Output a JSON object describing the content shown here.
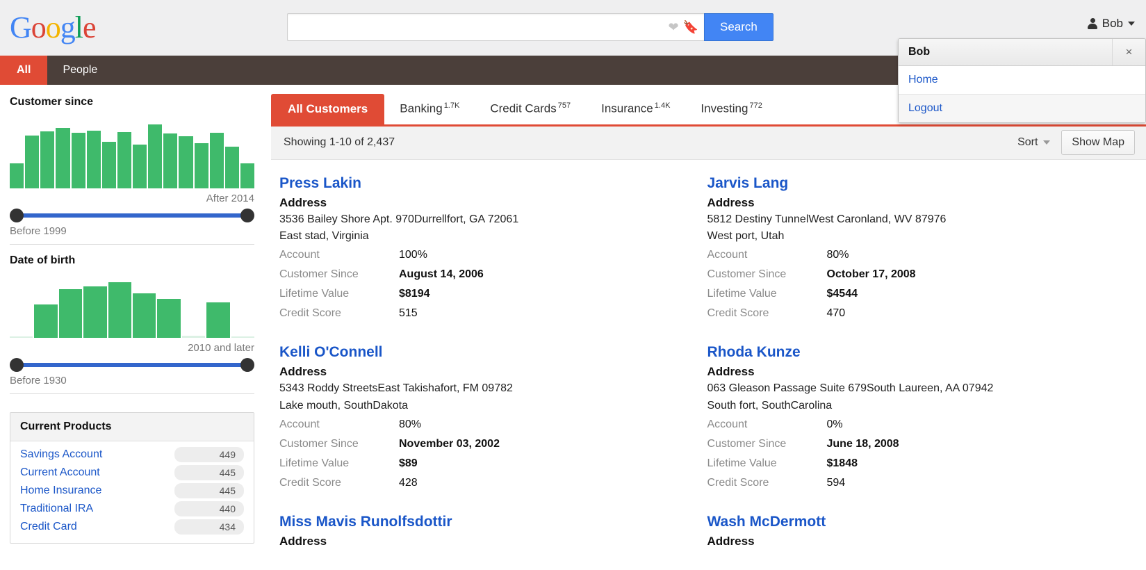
{
  "header": {
    "logo_letters": [
      "G",
      "o",
      "o",
      "g",
      "l",
      "e"
    ],
    "search": {
      "value": "",
      "placeholder": "",
      "button_label": "Search",
      "favorite_icon": "heart-icon",
      "bookmark_icon": "bookmark-icon"
    },
    "user": {
      "name": "Bob",
      "avatar_icon": "user-icon",
      "caret_icon": "chevron-down-icon"
    },
    "dropdown": {
      "title": "Bob",
      "close_label": "×",
      "items": [
        {
          "label": "Home"
        },
        {
          "label": "Logout"
        }
      ]
    }
  },
  "navbar": {
    "items": [
      {
        "label": "All",
        "active": true
      },
      {
        "label": "People",
        "active": false
      }
    ]
  },
  "sidebar": {
    "facets": [
      {
        "title": "Customer since",
        "max_label": "After 2014",
        "min_label": "Before 1999"
      },
      {
        "title": "Date of birth",
        "max_label": "2010 and later",
        "min_label": "Before 1930"
      }
    ],
    "products": {
      "title": "Current Products",
      "rows": [
        {
          "label": "Savings Account",
          "count": "449"
        },
        {
          "label": "Current Account",
          "count": "445"
        },
        {
          "label": "Home Insurance",
          "count": "445"
        },
        {
          "label": "Traditional IRA",
          "count": "440"
        },
        {
          "label": "Credit Card",
          "count": "434"
        }
      ]
    }
  },
  "main": {
    "tabs": [
      {
        "label": "All Customers",
        "count": "",
        "active": true
      },
      {
        "label": "Banking",
        "count": "1.7K",
        "active": false
      },
      {
        "label": "Credit Cards",
        "count": "757",
        "active": false
      },
      {
        "label": "Insurance",
        "count": "1.4K",
        "active": false
      },
      {
        "label": "Investing",
        "count": "772",
        "active": false
      }
    ],
    "toolbar": {
      "showing": "Showing 1-10 of 2,437",
      "sort_label": "Sort",
      "map_button": "Show Map"
    },
    "field_labels": {
      "address": "Address",
      "account": "Account",
      "customer_since": "Customer Since",
      "lifetime_value": "Lifetime Value",
      "credit_score": "Credit Score"
    },
    "customers": [
      {
        "name": "Press Lakin",
        "addr1": "3536 Bailey Shore Apt. 970Durrellfort, GA 72061",
        "addr2": "East stad, Virginia",
        "account": "100%",
        "customer_since": "August 14, 2006",
        "lifetime_value": "$8194",
        "credit_score": "515"
      },
      {
        "name": "Jarvis Lang",
        "addr1": "5812 Destiny TunnelWest Caronland, WV 87976",
        "addr2": "West port, Utah",
        "account": "80%",
        "customer_since": "October 17, 2008",
        "lifetime_value": "$4544",
        "credit_score": "470"
      },
      {
        "name": "Kelli O'Connell",
        "addr1": "5343 Roddy StreetsEast Takishafort, FM 09782",
        "addr2": "Lake mouth, SouthDakota",
        "account": "80%",
        "customer_since": "November 03, 2002",
        "lifetime_value": "$89",
        "credit_score": "428"
      },
      {
        "name": "Rhoda Kunze",
        "addr1": "063 Gleason Passage Suite 679South Laureen, AA 07942",
        "addr2": "South fort, SouthCarolina",
        "account": "0%",
        "customer_since": "June 18, 2008",
        "lifetime_value": "$1848",
        "credit_score": "594"
      },
      {
        "name": "Miss Mavis Runolfsdottir",
        "addr1": "",
        "addr2": "",
        "account": "",
        "customer_since": "",
        "lifetime_value": "",
        "credit_score": ""
      },
      {
        "name": "Wash McDermott",
        "addr1": "",
        "addr2": "",
        "account": "",
        "customer_since": "",
        "lifetime_value": "",
        "credit_score": ""
      }
    ]
  },
  "colors": {
    "accent_red": "#e04b35",
    "nav_brown": "#4b3f3a",
    "link_blue": "#1a56c8",
    "bar_green": "#3fba6b",
    "slider_blue": "#3366cc",
    "search_blue": "#4285F4"
  },
  "chart_data": [
    {
      "type": "bar",
      "title": "Customer since",
      "xlabel": "",
      "ylabel": "",
      "categories": [
        "b1",
        "b2",
        "b3",
        "b4",
        "b5",
        "b6",
        "b7",
        "b8",
        "b9",
        "b10",
        "b11",
        "b12",
        "b13",
        "b14",
        "b15",
        "b16"
      ],
      "values": [
        34,
        72,
        78,
        83,
        76,
        79,
        64,
        77,
        60,
        88,
        75,
        71,
        62,
        76,
        57,
        34
      ],
      "ylim": [
        0,
        100
      ],
      "grid": false,
      "legend": "none",
      "range_min_label": "Before 1999",
      "range_max_label": "After 2014"
    },
    {
      "type": "bar",
      "title": "Date of birth",
      "xlabel": "",
      "ylabel": "",
      "categories": [
        "d1",
        "d2",
        "d3",
        "d4",
        "d5",
        "d6",
        "d7",
        "d8",
        "d9",
        "d10"
      ],
      "values": [
        2,
        52,
        76,
        80,
        87,
        70,
        61,
        3,
        55,
        2
      ],
      "ylim": [
        0,
        100
      ],
      "grid": false,
      "legend": "none",
      "range_min_label": "Before 1930",
      "range_max_label": "2010 and later"
    }
  ]
}
